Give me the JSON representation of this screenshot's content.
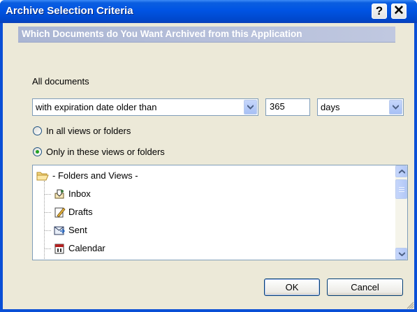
{
  "window": {
    "title": "Archive Selection Criteria",
    "help_label": "?",
    "close_label": "✕"
  },
  "banner": {
    "text": "Which Documents do You Want Archived from this Application"
  },
  "criteria": {
    "section_label": "All documents",
    "condition": {
      "selected": "with expiration date older than"
    },
    "amount": {
      "value": "365"
    },
    "unit": {
      "selected": "days"
    }
  },
  "scope": {
    "options": [
      {
        "label": "In all views or folders",
        "selected": false
      },
      {
        "label": "Only in these views or folders",
        "selected": true
      }
    ]
  },
  "folders": {
    "root": {
      "label": "- Folders and Views -",
      "icon": "open-folder-icon"
    },
    "items": [
      {
        "label": "Inbox",
        "icon": "inbox-icon"
      },
      {
        "label": "Drafts",
        "icon": "drafts-icon"
      },
      {
        "label": "Sent",
        "icon": "sent-icon"
      },
      {
        "label": "Calendar",
        "icon": "calendar-icon"
      }
    ]
  },
  "buttons": {
    "ok": "OK",
    "cancel": "Cancel"
  },
  "colors": {
    "titlebar": "#0054e3",
    "dialog_bg": "#ece9d8",
    "banner": "#aab5d3",
    "radio_dot": "#21a121"
  }
}
